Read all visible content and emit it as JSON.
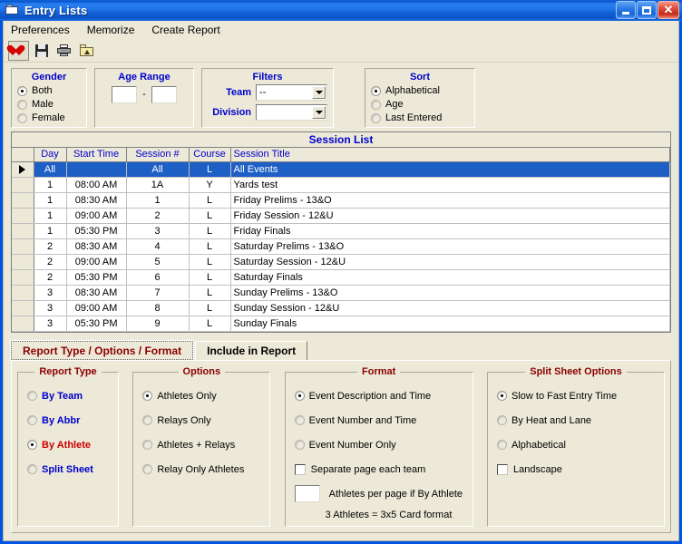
{
  "window": {
    "title": "Entry Lists",
    "icon": "folder-window-icon",
    "minimize_label": "",
    "maximize_label": "",
    "close_label": "✕"
  },
  "menubar": {
    "items": [
      {
        "label": "Preferences"
      },
      {
        "label": "Memorize"
      },
      {
        "label": "Create Report"
      }
    ]
  },
  "toolbar": {
    "buttons": [
      {
        "name": "favorite-heart-button",
        "icon": "heart-icon",
        "pressed": true
      },
      {
        "name": "save-button",
        "icon": "floppy-disk-icon",
        "pressed": false
      },
      {
        "name": "print-button",
        "icon": "printer-icon",
        "pressed": false
      },
      {
        "name": "export-folder-button",
        "icon": "folder-up-icon",
        "pressed": false
      }
    ]
  },
  "filters": {
    "gender": {
      "title": "Gender",
      "options": [
        {
          "label": "Both",
          "selected": true
        },
        {
          "label": "Male",
          "selected": false
        },
        {
          "label": "Female",
          "selected": false
        }
      ]
    },
    "age_range": {
      "title": "Age Range",
      "from_value": "",
      "to_value": "",
      "separator": "-"
    },
    "filters_group": {
      "title": "Filters",
      "team_label": "Team",
      "team_value": "--",
      "division_label": "Division",
      "division_value": ""
    },
    "sort": {
      "title": "Sort",
      "options": [
        {
          "label": "Alphabetical",
          "selected": true
        },
        {
          "label": "Age",
          "selected": false
        },
        {
          "label": "Last Entered",
          "selected": false
        }
      ]
    }
  },
  "session_list": {
    "caption": "Session List",
    "columns": [
      "",
      "Day",
      "Start Time",
      "Session #",
      "Course",
      "Session Title"
    ],
    "rows": [
      {
        "selected": true,
        "marker": "▶",
        "day": "All",
        "start_time": "",
        "session": "All",
        "course": "L",
        "title": "All Events"
      },
      {
        "selected": false,
        "marker": "",
        "day": "1",
        "start_time": "08:00 AM",
        "session": "1A",
        "course": "Y",
        "title": "Yards test"
      },
      {
        "selected": false,
        "marker": "",
        "day": "1",
        "start_time": "08:30 AM",
        "session": "1",
        "course": "L",
        "title": "Friday Prelims - 13&O"
      },
      {
        "selected": false,
        "marker": "",
        "day": "1",
        "start_time": "09:00 AM",
        "session": "2",
        "course": "L",
        "title": "Friday Session - 12&U"
      },
      {
        "selected": false,
        "marker": "",
        "day": "1",
        "start_time": "05:30 PM",
        "session": "3",
        "course": "L",
        "title": "Friday Finals"
      },
      {
        "selected": false,
        "marker": "",
        "day": "2",
        "start_time": "08:30 AM",
        "session": "4",
        "course": "L",
        "title": "Saturday Prelims - 13&O"
      },
      {
        "selected": false,
        "marker": "",
        "day": "2",
        "start_time": "09:00 AM",
        "session": "5",
        "course": "L",
        "title": "Saturday Session - 12&U"
      },
      {
        "selected": false,
        "marker": "",
        "day": "2",
        "start_time": "05:30 PM",
        "session": "6",
        "course": "L",
        "title": "Saturday Finals"
      },
      {
        "selected": false,
        "marker": "",
        "day": "3",
        "start_time": "08:30 AM",
        "session": "7",
        "course": "L",
        "title": "Sunday Prelims - 13&O"
      },
      {
        "selected": false,
        "marker": "",
        "day": "3",
        "start_time": "09:00 AM",
        "session": "8",
        "course": "L",
        "title": "Sunday Session - 12&U"
      },
      {
        "selected": false,
        "marker": "",
        "day": "3",
        "start_time": "05:30 PM",
        "session": "9",
        "course": "L",
        "title": "Sunday Finals"
      }
    ]
  },
  "tabs": [
    {
      "label": "Report Type / Options / Format",
      "active": true
    },
    {
      "label": "Include in Report",
      "active": false
    }
  ],
  "report_type": {
    "title": "Report Type",
    "options": [
      {
        "label": "By Team",
        "selected": false
      },
      {
        "label": "By Abbr",
        "selected": false
      },
      {
        "label": "By Athlete",
        "selected": true
      },
      {
        "label": "Split Sheet",
        "selected": false
      }
    ]
  },
  "options": {
    "title": "Options",
    "items": [
      {
        "label": "Athletes Only",
        "selected": true
      },
      {
        "label": "Relays Only",
        "selected": false
      },
      {
        "label": "Athletes + Relays",
        "selected": false
      },
      {
        "label": "Relay Only Athletes",
        "selected": false
      }
    ]
  },
  "format": {
    "title": "Format",
    "radios": [
      {
        "label": "Event Description and Time",
        "selected": true
      },
      {
        "label": "Event Number and Time",
        "selected": false
      },
      {
        "label": "Event Number Only",
        "selected": false
      }
    ],
    "separate_page_label": "Separate page each team",
    "separate_page_checked": false,
    "athletes_per_page_value": "",
    "athletes_per_page_label": "Athletes per page if By Athlete",
    "note": "3 Athletes = 3x5 Card format"
  },
  "split_sheet": {
    "title": "Split Sheet Options",
    "radios": [
      {
        "label": "Slow to Fast Entry Time",
        "selected": true
      },
      {
        "label": "By Heat and Lane",
        "selected": false
      },
      {
        "label": "Alphabetical",
        "selected": false
      }
    ],
    "landscape_label": "Landscape",
    "landscape_checked": false
  },
  "colors": {
    "title_bar": "#0a57cf",
    "face": "#ece9d8",
    "label_blue": "#0000cc",
    "legend_red": "#8b0000",
    "selected_red": "#cc0000",
    "grid_selection": "#1d5fc4"
  }
}
